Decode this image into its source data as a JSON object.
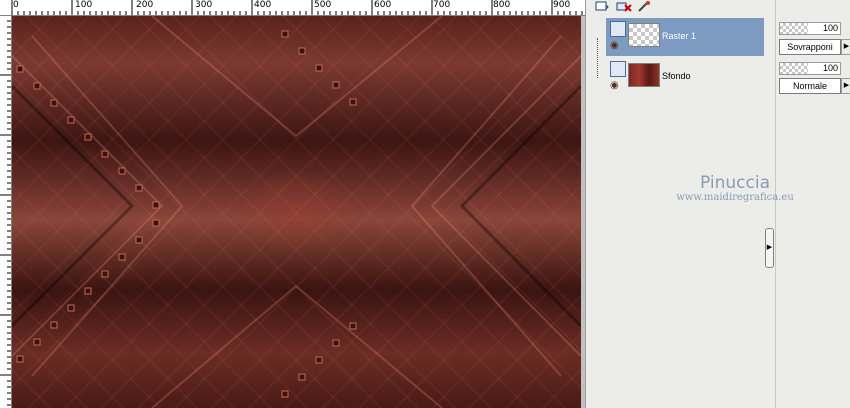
{
  "ruler": {
    "labels": [
      "0",
      "100",
      "200",
      "300",
      "400",
      "500",
      "600",
      "700",
      "800",
      "900"
    ]
  },
  "toolbar": {
    "icons": [
      "layer-new-icon",
      "delete-layer-icon",
      "edit-icon"
    ]
  },
  "layers": [
    {
      "name": "Raster 1",
      "selected": true,
      "thumbnail": "transparent",
      "visible": true
    },
    {
      "name": "Sfondo",
      "selected": false,
      "thumbnail": "background",
      "visible": true
    }
  ],
  "layer_props": [
    {
      "opacity": "100",
      "blend_mode": "Sovrapponi"
    },
    {
      "opacity": "100",
      "blend_mode": "Normale"
    }
  ],
  "watermark": {
    "title": "Pinuccia",
    "url": "www.maidiregrafica.eu"
  },
  "colors": {
    "selected_layer": "#7d9ac0",
    "panel_bg": "#ecece9",
    "canvas_dark": "#3d1512",
    "canvas_light": "#8a4639",
    "watermark": "#8a9bb8"
  }
}
